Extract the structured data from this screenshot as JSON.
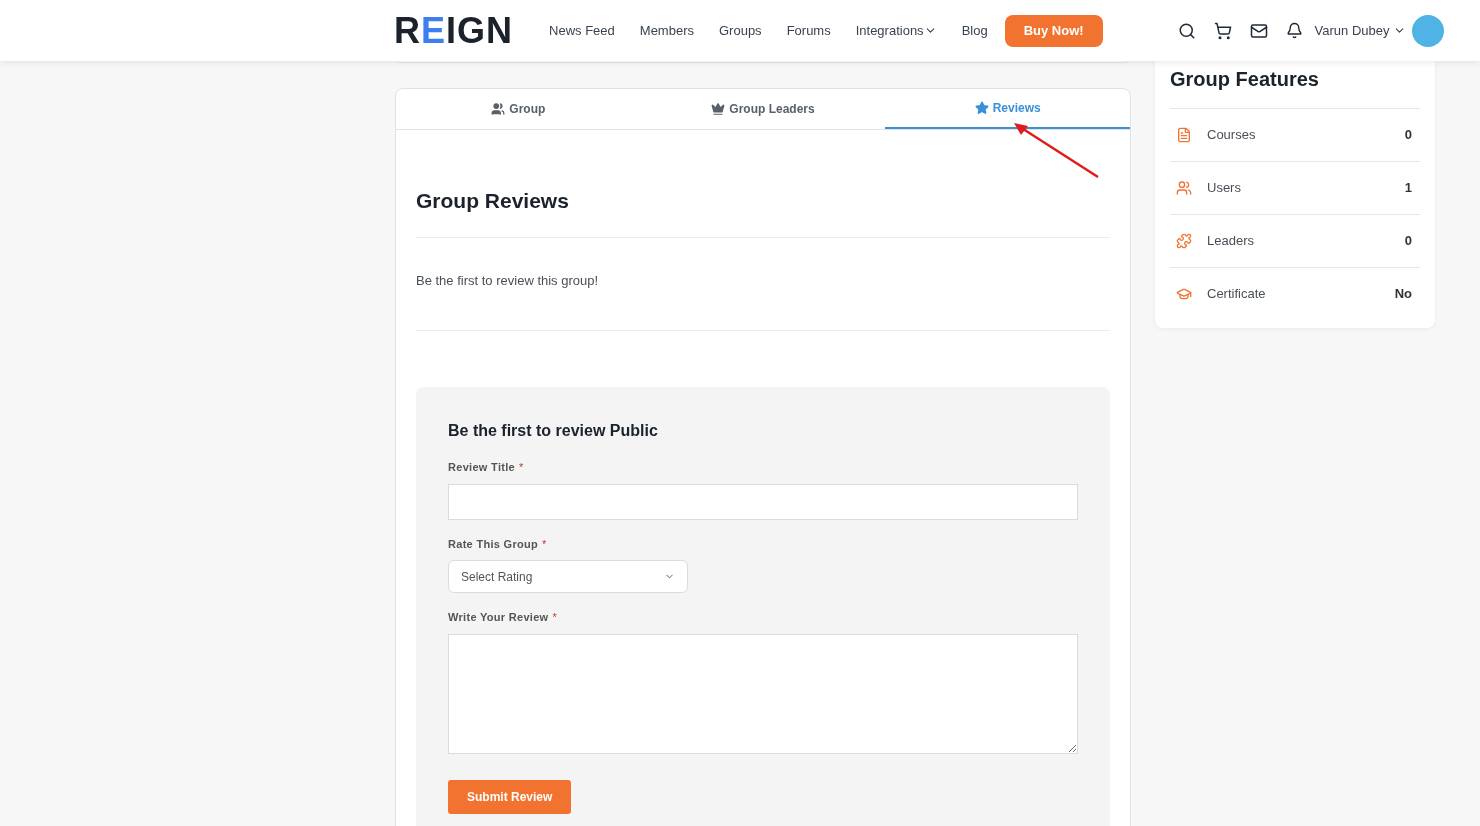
{
  "header": {
    "logo": "REIGN",
    "nav": [
      {
        "label": "News Feed",
        "dropdown": false
      },
      {
        "label": "Members",
        "dropdown": false
      },
      {
        "label": "Groups",
        "dropdown": false
      },
      {
        "label": "Forums",
        "dropdown": false
      },
      {
        "label": "Integrations",
        "dropdown": true
      },
      {
        "label": "Blog",
        "dropdown": false
      }
    ],
    "cta": "Buy Now!",
    "user": "Varun Dubey"
  },
  "tabs": [
    {
      "label": "Group",
      "selected": false
    },
    {
      "label": "Group Leaders",
      "selected": false
    },
    {
      "label": "Reviews",
      "selected": true
    }
  ],
  "reviews": {
    "title": "Group Reviews",
    "empty_message": "Be the first to review this group!"
  },
  "form": {
    "title": "Be the first to review Public",
    "fields": [
      {
        "kind": "text",
        "label": "Review Title",
        "required_mark": "*"
      },
      {
        "kind": "select",
        "label": "Rate This Group",
        "required_mark": "*",
        "placeholder": "Select Rating"
      },
      {
        "kind": "textarea",
        "label": "Write Your Review",
        "required_mark": "*"
      }
    ],
    "submit": "Submit Review"
  },
  "sidebar": {
    "title": "Group Features",
    "items": [
      {
        "label": "Courses",
        "value": "0"
      },
      {
        "label": "Users",
        "value": "1"
      },
      {
        "label": "Leaders",
        "value": "0"
      },
      {
        "label": "Certificate",
        "value": "No"
      }
    ]
  }
}
